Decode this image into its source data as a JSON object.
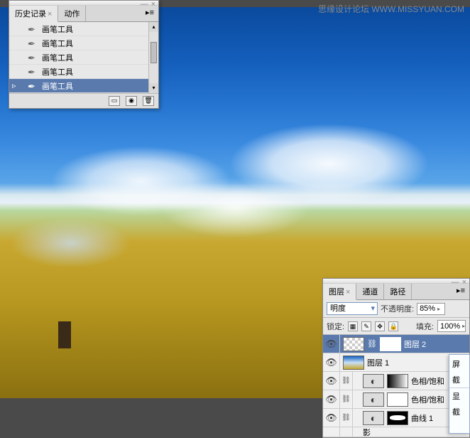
{
  "watermark": "思缘设计论坛  WWW.MISSYUAN.COM",
  "history_panel": {
    "tabs": [
      {
        "label": "历史记录",
        "active": true
      },
      {
        "label": "动作",
        "active": false
      }
    ],
    "items": [
      {
        "label": "画笔工具",
        "selected": false
      },
      {
        "label": "画笔工具",
        "selected": false
      },
      {
        "label": "画笔工具",
        "selected": false
      },
      {
        "label": "画笔工具",
        "selected": false
      },
      {
        "label": "画笔工具",
        "selected": true
      }
    ]
  },
  "layers_panel": {
    "tabs": [
      {
        "label": "图层",
        "active": true
      },
      {
        "label": "通道",
        "active": false
      },
      {
        "label": "路径",
        "active": false
      }
    ],
    "blend_mode": "明度",
    "opacity_label": "不透明度:",
    "opacity_value": "85%",
    "lock_label": "锁定:",
    "fill_label": "填充:",
    "fill_value": "100%",
    "layers": [
      {
        "name": "图层 2",
        "type": "raster-mask",
        "selected": true
      },
      {
        "name": "图层 1",
        "type": "image"
      },
      {
        "name": "色相/饱和",
        "type": "adjustment",
        "mask": "grad"
      },
      {
        "name": "色相/饱和",
        "type": "adjustment",
        "mask": "white"
      },
      {
        "name": "曲线 1",
        "type": "adjustment",
        "mask": "curve"
      },
      {
        "name": "影",
        "type": "partial"
      }
    ]
  },
  "context_menu": {
    "items": [
      "屏",
      "截",
      "显",
      "截"
    ]
  }
}
